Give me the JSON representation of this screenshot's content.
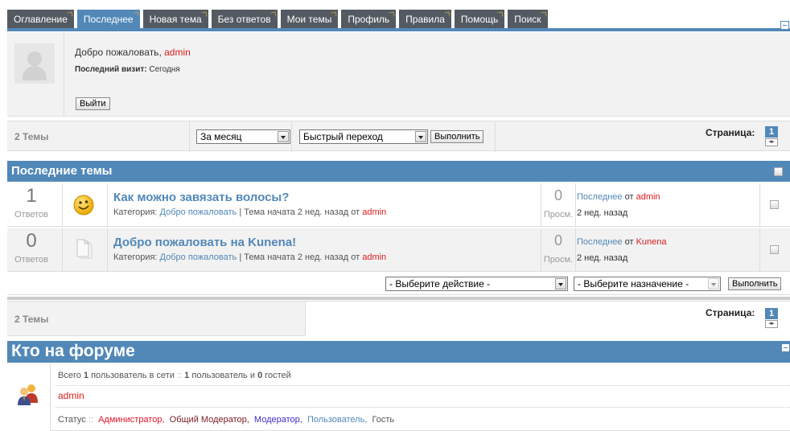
{
  "tabs": [
    "Оглавление",
    "Последнее",
    "Новая тема",
    "Без ответов",
    "Мои темы",
    "Профиль",
    "Правила",
    "Помощь",
    "Поиск"
  ],
  "active_tab": "Последнее",
  "profile": {
    "welcome_text": "Добро пожаловать, ",
    "username": "admin",
    "last_visit_label": "Последний визит:",
    "last_visit_value": "Сегодня",
    "logout_label": "Выйти"
  },
  "top_pager": {
    "count": "2 Темы",
    "period_select": "За месяц",
    "jump_select": "Быстрый переход",
    "go_label": "Выполнить",
    "page_label": "Страница:",
    "page_current": "1"
  },
  "latest_section": {
    "title": "Последние темы"
  },
  "topics": [
    {
      "replies": "1",
      "replies_label": "Ответов",
      "icon": "smiley-icon",
      "title": "Как можно завязать волосы?",
      "category_label": "Категория:",
      "category": "Добро пожаловать",
      "started_text": "| Тема начата 2 нед. назад от",
      "author": "admin",
      "views": "0",
      "views_label": "Просм.",
      "last_label": "Последнее",
      "last_from": "от",
      "last_by": "admin",
      "last_time": "2 нед. назад"
    },
    {
      "replies": "0",
      "replies_label": "Ответов",
      "icon": "document-icon",
      "title": "Добро пожаловать на Kunena!",
      "category_label": "Категория:",
      "category": "Добро пожаловать",
      "started_text": "| Тема начата 2 нед. назад от",
      "author": "admin",
      "views": "0",
      "views_label": "Просм.",
      "last_label": "Последнее",
      "last_from": "от",
      "last_by": "Kunena",
      "last_time": "2 нед. назад"
    }
  ],
  "actions": {
    "action_select": "- Выберите действие -",
    "target_select": "- Выберите назначение -",
    "go_label": "Выполнить"
  },
  "bottom_pager": {
    "count": "2 Темы",
    "page_label": "Страница:",
    "page_current": "1"
  },
  "who": {
    "title": "Кто на форуме",
    "total_a": "Всего",
    "total_n": "1",
    "total_b": "пользователь в сети",
    "sep": "::",
    "users_n": "1",
    "users_b": "пользователь и",
    "guests_n": "0",
    "guests_b": "гостей",
    "online_user": "admin",
    "status_label": "Статус",
    "roles": [
      "Администратор,",
      "Общий Модератор,",
      "Модератор,",
      "Пользователь,",
      "Гость"
    ]
  },
  "colors": {
    "accent": "#5288b8",
    "tab_dark": "#545a62",
    "link_red": "#d91d1d"
  }
}
